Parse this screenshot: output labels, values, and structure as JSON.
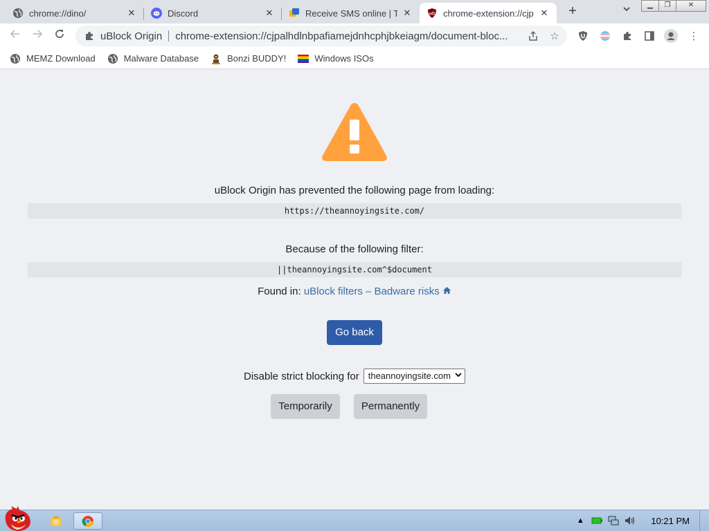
{
  "tabs": [
    {
      "title": "chrome://dino/",
      "favicon": "globe-icon",
      "active": false
    },
    {
      "title": "Discord",
      "favicon": "discord-icon",
      "active": false
    },
    {
      "title": "Receive SMS online | Te",
      "favicon": "sms-icon",
      "active": false
    },
    {
      "title": "chrome-extension://cjp",
      "favicon": "ublock-icon",
      "active": true
    }
  ],
  "toolbar": {
    "omnibox_extension_name": "uBlock Origin",
    "omnibox_url": "chrome-extension://cjpalhdlnbpafiamejdnhcphjbkeiagm/document-bloc..."
  },
  "bookmarks": [
    {
      "label": "MEMZ Download",
      "icon": "globe-icon"
    },
    {
      "label": "Malware Database",
      "icon": "globe-icon"
    },
    {
      "label": "Bonzi BUDDY!",
      "icon": "bonzi-icon"
    },
    {
      "label": "Windows ISOs",
      "icon": "rainbow-flag-icon"
    }
  ],
  "page": {
    "prevented_text": "uBlock Origin has prevented the following page from loading:",
    "blocked_url": "https://theannoyingsite.com/",
    "filter_text": "Because of the following filter:",
    "filter_value": "||theannoyingsite.com^$document",
    "found_in_label": "Found in:",
    "found_in_link": "uBlock filters – Badware risks",
    "go_back_label": "Go back",
    "disable_strict_label": "Disable strict blocking for",
    "disable_strict_selected": "theannoyingsite.com",
    "temporarily_label": "Temporarily",
    "permanently_label": "Permanently"
  },
  "taskbar": {
    "clock": "10:21 PM"
  },
  "colors": {
    "warning": "#ffa23e",
    "go_back_bg": "#2e5ca8",
    "link": "#3b6ea5",
    "page_bg": "#eef0f3"
  }
}
